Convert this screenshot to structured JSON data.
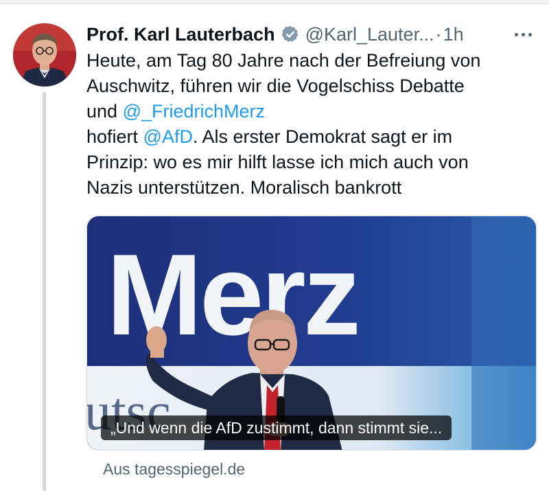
{
  "tweet": {
    "author_name": "Prof. Karl Lauterbach",
    "handle": "@Karl_Lauter...",
    "separator": "·",
    "time": "1h",
    "verified": true,
    "text": {
      "line1": "Heute, am Tag 80 Jahre nach der Befreiung von",
      "line2": "Auschwitz, führen wir die Vogelschiss Debatte",
      "line3_prefix": "und ",
      "line3_mention": "@_FriedrichMerz",
      "line4_prefix": "hofiert ",
      "line4_mention": "@AfD",
      "line4_suffix": ". Als erster Demokrat sagt er im",
      "line5": "Prinzip: wo es mir hilft lasse ich mich auch von",
      "line6": "Nazis unterstützen. Moralisch bankrott"
    },
    "media": {
      "backdrop_text": "Merz",
      "backdrop_partial_text": "utsc",
      "caption": "„Und wenn die AfD zustimmt, dann stimmt sie..."
    },
    "link_source": "Aus tagesspiegel.de"
  },
  "colors": {
    "link": "#1d9bf0",
    "verified_badge": "#829aab",
    "secondary_text": "#536471"
  },
  "icons": {
    "verified": "verified-badge-icon",
    "more": "more-options-icon"
  }
}
